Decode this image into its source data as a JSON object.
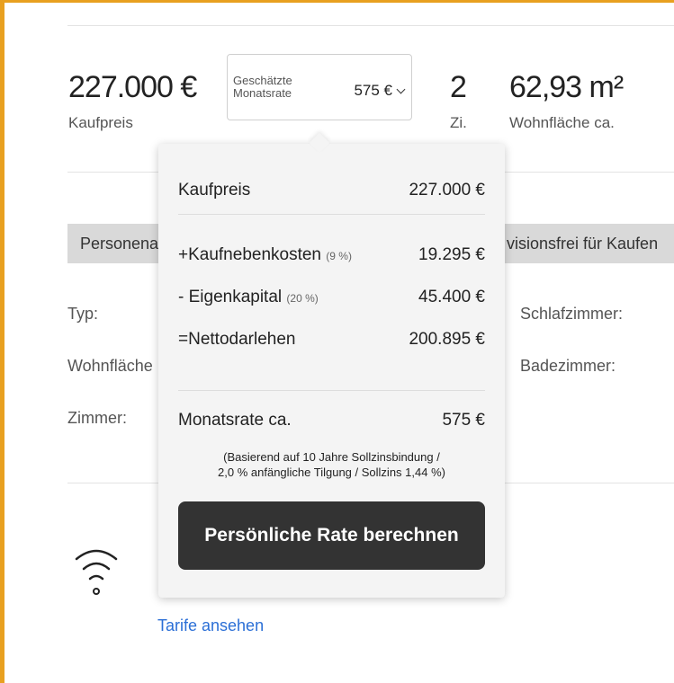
{
  "summary": {
    "price_value": "227.000 €",
    "price_label": "Kaufpreis",
    "rate_label": "Geschätzte Monatsrate",
    "rate_value": "575 €",
    "rooms_value": "2",
    "rooms_label": "Zi.",
    "area_value": "62,93 m²",
    "area_label": "Wohnfläche ca."
  },
  "bands": {
    "left": "Personena",
    "right": "visionsfrei für Kaufen"
  },
  "details_left": [
    "Typ:",
    "Wohnfläche",
    "Zimmer:"
  ],
  "details_right": [
    "Schlafzimmer:",
    "Badezimmer:"
  ],
  "link_text": "Tarife ansehen",
  "popup": {
    "rows": {
      "kaufpreis_label": "Kaufpreis",
      "kaufpreis_value": "227.000 €",
      "nebenkosten_label": "+Kaufnebenkosten",
      "nebenkosten_pct": "(9 %)",
      "nebenkosten_value": "19.295 €",
      "eigenkapital_label": "- Eigenkapital",
      "eigenkapital_pct": "(20 %)",
      "eigenkapital_value": "45.400 €",
      "darlehen_label": "=Nettodarlehen",
      "darlehen_value": "200.895 €",
      "monatsrate_label": "Monatsrate ca.",
      "monatsrate_value": "575 €"
    },
    "note_line1": "(Basierend auf 10 Jahre Sollzinsbindung /",
    "note_line2": "2,0 % anfängliche Tilgung / Sollzins 1,44 %)",
    "button_label": "Persönliche Rate berechnen"
  },
  "colors": {
    "accent_border": "#e8a020",
    "button_bg": "#333333",
    "link": "#2b6fd6"
  },
  "icons": [
    "chevron-down-icon",
    "wifi-icon"
  ]
}
